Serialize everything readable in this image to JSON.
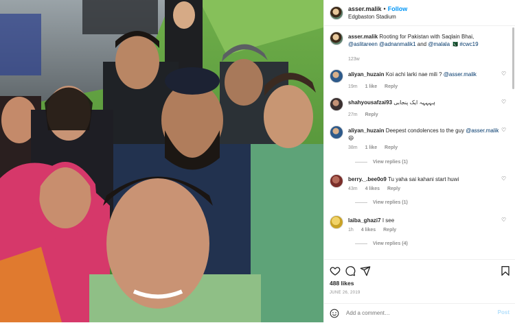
{
  "header": {
    "username": "asser.malik",
    "separator": "•",
    "follow_label": "Follow",
    "location": "Edgbaston Stadium"
  },
  "caption": {
    "username": "asser.malik",
    "text_parts": [
      "Rooting for Pakistan with Saqlain Bhai, ",
      "@aslitareen",
      " ",
      "@adnanmalik1",
      " and ",
      "@malala",
      " 🇵🇰 ",
      "#cwc19"
    ],
    "time": "123w"
  },
  "comments": [
    {
      "username": "aliyan_huzain",
      "text": "Koi achi larki nae mili ? ",
      "mention": "@asser.malik",
      "time": "19m",
      "likes": "1 like",
      "reply": "Reply",
      "view_replies": ""
    },
    {
      "username": "shahyousafzai93",
      "text": "ہہہہہ ایک پنجابی",
      "mention": "",
      "time": "27m",
      "likes": "",
      "reply": "Reply",
      "view_replies": ""
    },
    {
      "username": "aliyan_huzain",
      "text": "Deepest condolences to the guy ",
      "mention": "@asser.malik",
      "extra": " 😆",
      "time": "38m",
      "likes": "1 like",
      "reply": "Reply",
      "view_replies": "View replies (1)"
    },
    {
      "username": "berry._.bee0o9",
      "text": "Tu yaha sai kahani start huwi",
      "mention": "",
      "time": "43m",
      "likes": "4 likes",
      "reply": "Reply",
      "view_replies": "View replies (1)"
    },
    {
      "username": "laiba_ghazi7",
      "text": "I see",
      "mention": "",
      "time": "1h",
      "likes": "4 likes",
      "reply": "Reply",
      "view_replies": "View replies (4)"
    }
  ],
  "actions": {
    "icons": [
      "heart-icon",
      "comment-icon",
      "share-icon",
      "bookmark-icon"
    ],
    "likes_label": "488 likes",
    "date": "JUNE 26, 2019"
  },
  "add_comment": {
    "placeholder": "Add a comment…",
    "post_label": "Post"
  },
  "colors": {
    "link": "#0095f6",
    "mention": "#00376b",
    "muted": "#8e8e8e"
  }
}
